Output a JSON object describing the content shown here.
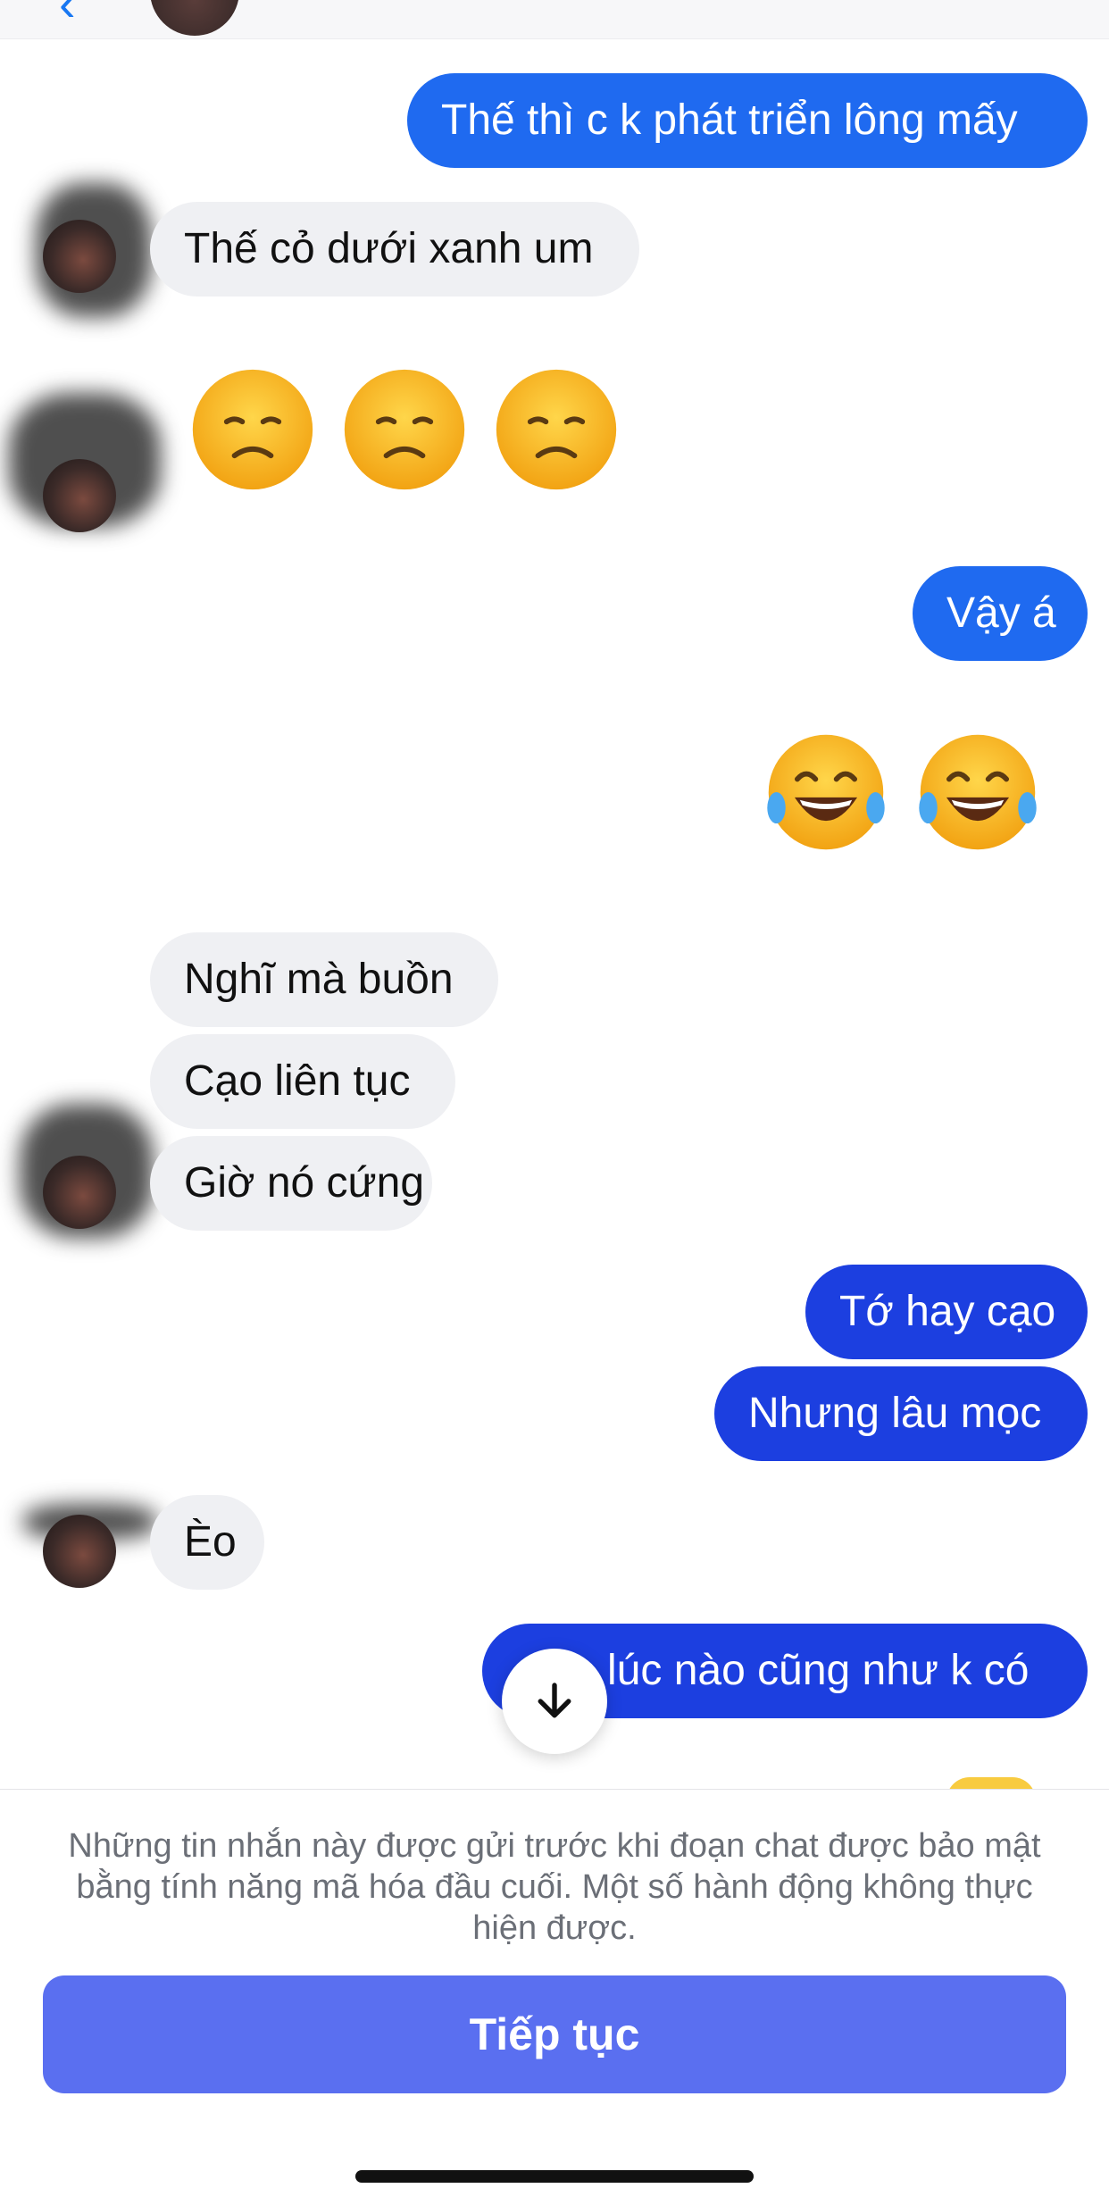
{
  "messages": {
    "m1": "Thế thì c k phát triển lông mấy",
    "m2": "Thế cỏ dưới xanh um",
    "m3": "Vậy á",
    "m4": "Nghĩ mà buồn",
    "m5": "Cạo liên tục",
    "m6": "Giờ nó cứng",
    "m7": "Tớ hay cạo",
    "m8": "Nhưng lâu mọc",
    "m9": "Èo",
    "m10": "lúc nào cũng như k có"
  },
  "emoji_messages": {
    "disappointed": [
      "disappointed-face",
      "disappointed-face",
      "disappointed-face"
    ],
    "laughing": [
      "face-with-tears-of-joy",
      "face-with-tears-of-joy"
    ]
  },
  "footer": {
    "notice": "Những tin nhắn này được gửi trước khi đoạn chat được bảo mật bằng tính năng mã hóa đầu cuối. Một số hành động không thực hiện được.",
    "continue_label": "Tiếp tục"
  },
  "icons": {
    "scroll_down": "arrow-down-icon",
    "back": "chevron-left-icon"
  },
  "colors": {
    "outgoing_bubble": "#1f6af0",
    "outgoing_bubble_deep": "#1c3fe0",
    "incoming_bubble": "#eff0f3",
    "continue_button": "#5a6ff0",
    "notice_text": "#6b6f77"
  }
}
